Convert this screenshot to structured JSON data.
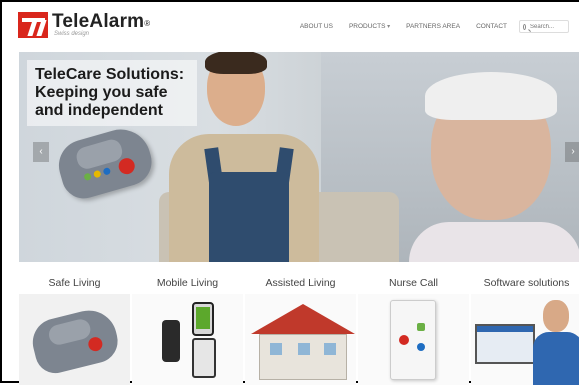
{
  "header": {
    "logo_name": "TeleAlarm",
    "logo_sub": "Swiss design",
    "nav": [
      {
        "label": "ABOUT US"
      },
      {
        "label": "PRODUCTS"
      },
      {
        "label": "PARTNERS AREA"
      },
      {
        "label": "CONTACT"
      }
    ],
    "search_placeholder": "Search..."
  },
  "hero": {
    "title_line1": "TeleCare Solutions:",
    "title_line2": "Keeping you safe",
    "title_line3": "and independent",
    "prev_arrow": "‹",
    "next_arrow": "›"
  },
  "categories": [
    {
      "label": "Safe Living"
    },
    {
      "label": "Mobile Living"
    },
    {
      "label": "Assisted Living"
    },
    {
      "label": "Nurse Call"
    },
    {
      "label": "Software solutions"
    }
  ],
  "colors": {
    "brand": "#d9261c",
    "alarm_red": "#d32a22"
  }
}
